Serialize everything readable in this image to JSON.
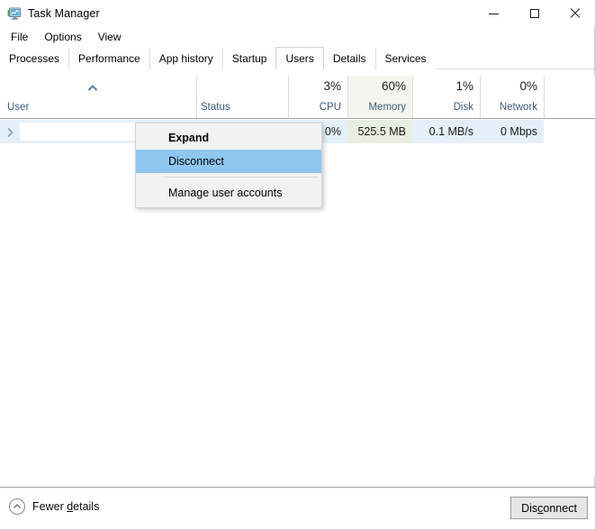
{
  "window": {
    "title": "Task Manager",
    "icon": "task-manager-monitor-icon",
    "controls": {
      "minimize": "minimize-icon",
      "maximize": "maximize-icon",
      "close": "close-icon"
    }
  },
  "menubar": {
    "items": [
      {
        "label": "File"
      },
      {
        "label": "Options"
      },
      {
        "label": "View"
      }
    ]
  },
  "tabs": {
    "active": "Users",
    "items": [
      {
        "label": "Processes",
        "active": false
      },
      {
        "label": "Performance",
        "active": false
      },
      {
        "label": "App history",
        "active": false
      },
      {
        "label": "Startup",
        "active": false
      },
      {
        "label": "Users",
        "active": true
      },
      {
        "label": "Details",
        "active": false
      },
      {
        "label": "Services",
        "active": false
      }
    ]
  },
  "table": {
    "sort": {
      "column": "User",
      "direction": "ascending",
      "indicator": "chevron-up-icon"
    },
    "highlighted_column": "Memory",
    "columns": [
      {
        "name": "User",
        "label": "User",
        "pct": "",
        "align": "left"
      },
      {
        "name": "Status",
        "label": "Status",
        "pct": "",
        "align": "left"
      },
      {
        "name": "CPU",
        "label": "CPU",
        "pct": "3%",
        "align": "right"
      },
      {
        "name": "Memory",
        "label": "Memory",
        "pct": "60%",
        "align": "right"
      },
      {
        "name": "Disk",
        "label": "Disk",
        "pct": "1%",
        "align": "right"
      },
      {
        "name": "Network",
        "label": "Network",
        "pct": "0%",
        "align": "right"
      }
    ],
    "rows": [
      {
        "expand_icon": "chevron-right-icon",
        "user": "",
        "status": "",
        "cpu": "0%",
        "memory": "525.5 MB",
        "disk": "0.1 MB/s",
        "network": "0 Mbps",
        "selected": true
      }
    ]
  },
  "context_menu": {
    "visible": true,
    "items": [
      {
        "label": "Expand",
        "bold": true,
        "selected": false,
        "separator_after": false
      },
      {
        "label": "Disconnect",
        "bold": false,
        "selected": true,
        "separator_after": true
      },
      {
        "label": "Manage user accounts",
        "bold": false,
        "selected": false,
        "separator_after": false
      }
    ]
  },
  "statusbar": {
    "fewer_details": {
      "label": "Fewer details",
      "accel": "d",
      "icon": "chevron-up-circle-icon"
    },
    "primary_button": {
      "label": "Disconnect",
      "accel": "c"
    }
  },
  "colors": {
    "row_selected": "#e4f0f9",
    "menu_highlight": "#8fc7f0",
    "sorted_column": "#f5f5ef",
    "header_label": "#3c5a78",
    "window_bg": "#ffffff",
    "menu_bg": "#f2f2f2",
    "button_bg": "#e6e6e6"
  }
}
